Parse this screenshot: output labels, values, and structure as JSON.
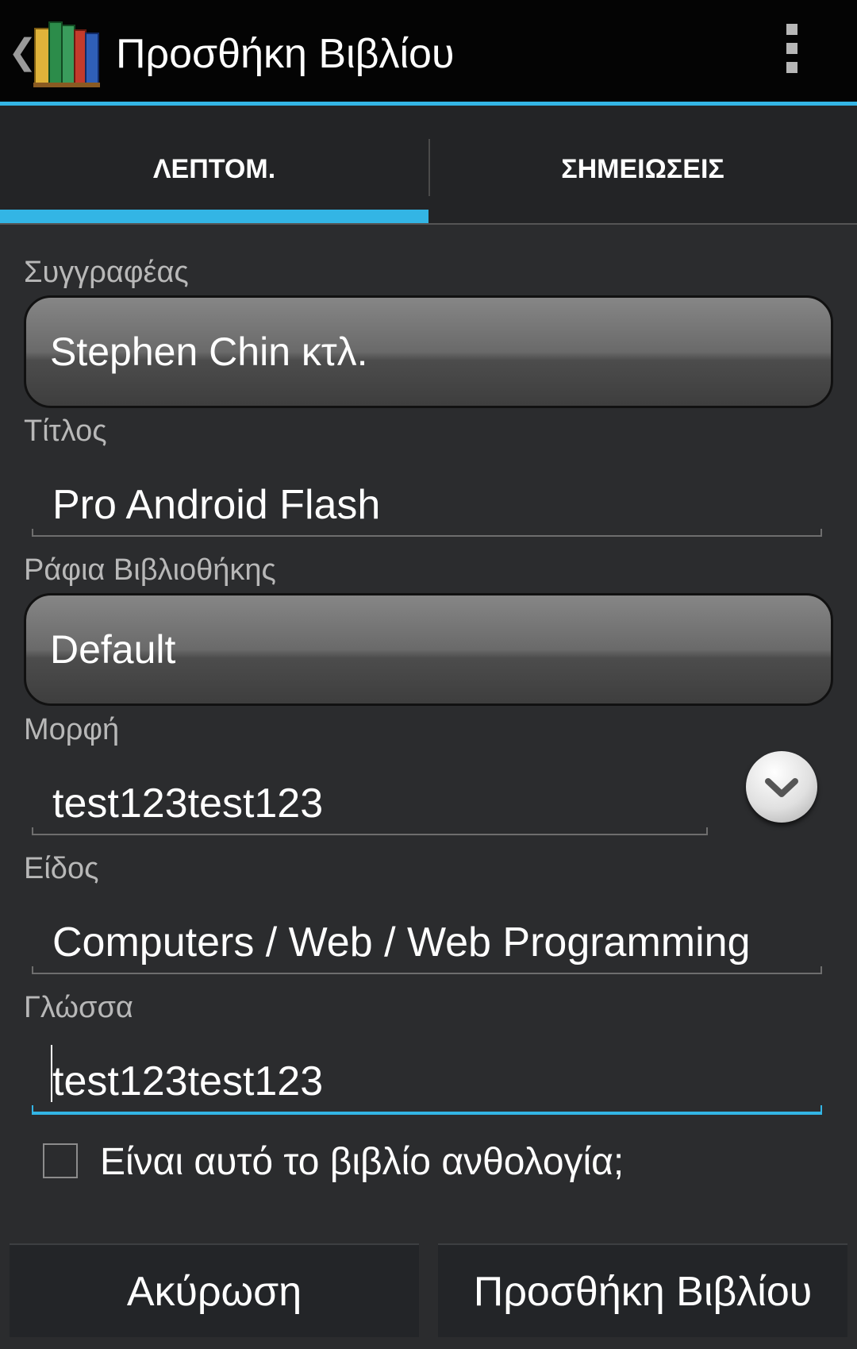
{
  "action_bar": {
    "title": "Προσθήκη Βιβλίου",
    "up_icon": "chevron-left-icon",
    "app_icon": "books-app-icon",
    "overflow_icon": "overflow-menu-icon",
    "accent": "#33b5e5"
  },
  "tabs": [
    {
      "label": "ΛΕΠΤΟΜ.",
      "selected": true
    },
    {
      "label": "ΣΗΜΕΙΩΣΕΙΣ",
      "selected": false
    }
  ],
  "form": {
    "author": {
      "label": "Συγγραφέας",
      "value": "Stephen Chin κτλ."
    },
    "title": {
      "label": "Τίτλος",
      "value": "Pro Android Flash"
    },
    "shelf": {
      "label": "Ράφια Βιβλιοθήκης",
      "value": "Default"
    },
    "format": {
      "label": "Μορφή",
      "value": "test123test123"
    },
    "genre": {
      "label": "Είδος",
      "value": "Computers / Web / Web Programming"
    },
    "language": {
      "label": "Γλώσσα",
      "value": "test123test123"
    },
    "anthology": {
      "label": "Είναι αυτό το βιβλίο ανθολογία;",
      "checked": false
    }
  },
  "buttons": {
    "cancel": "Ακύρωση",
    "add": "Προσθήκη Βιβλίου"
  }
}
